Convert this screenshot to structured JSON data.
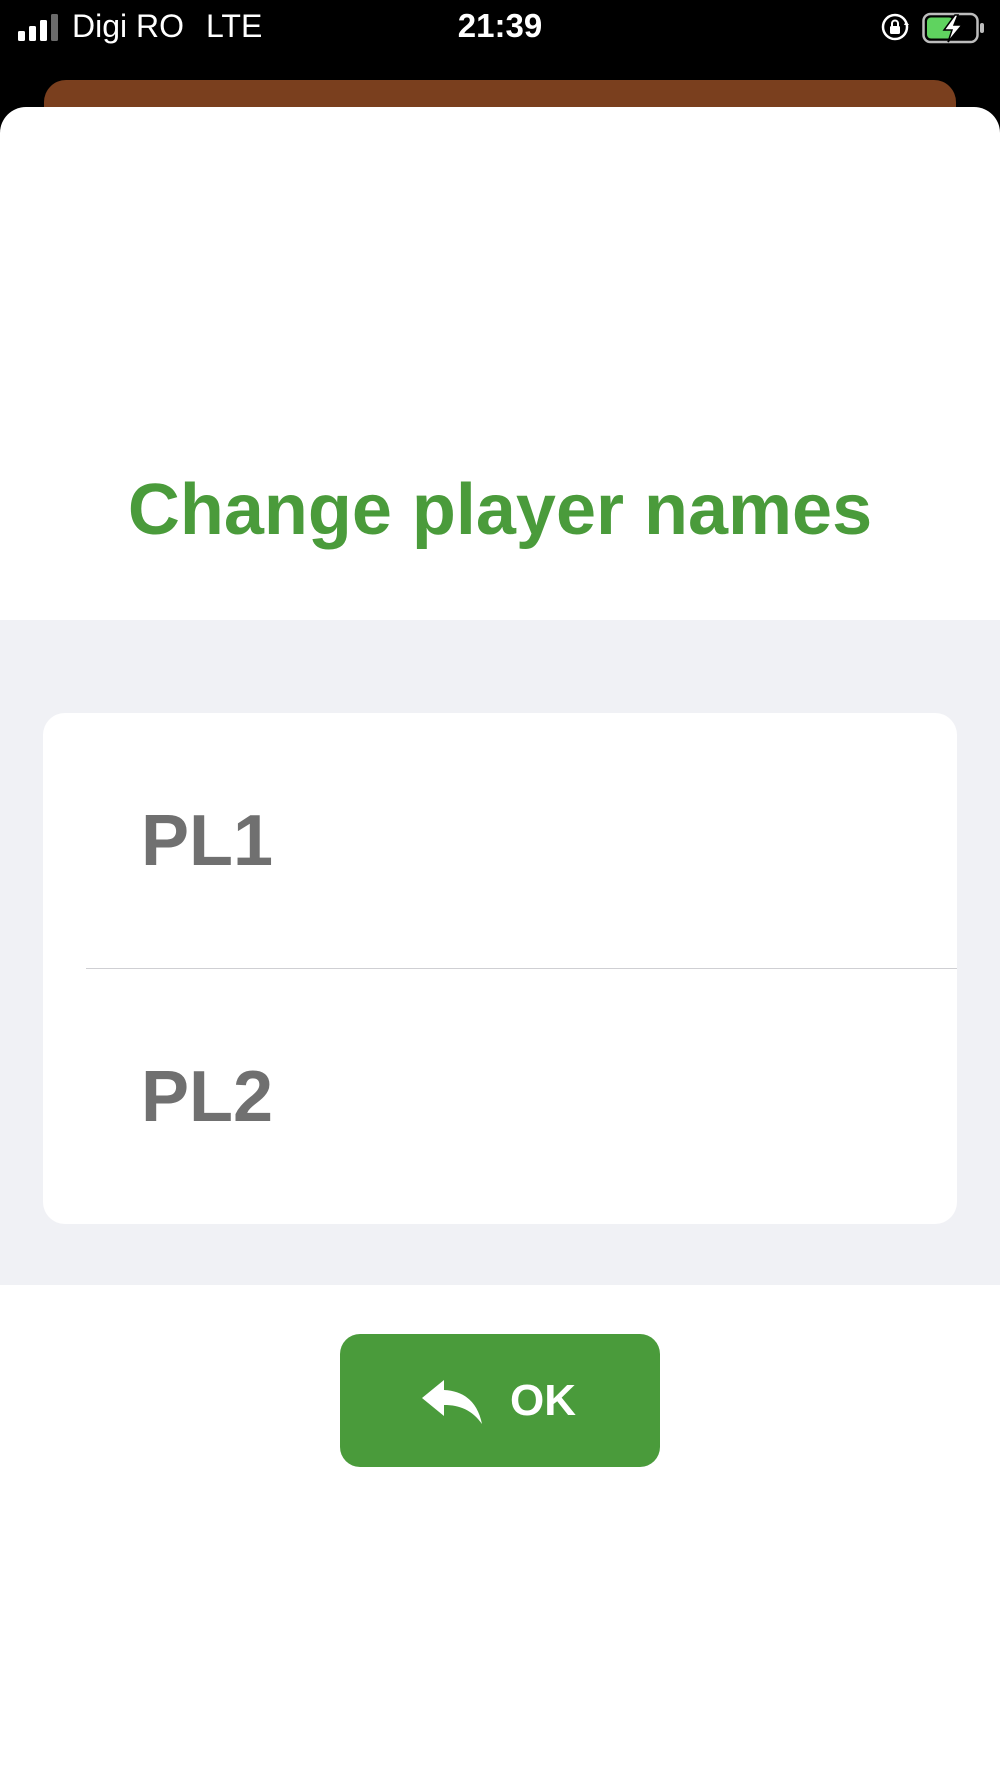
{
  "status_bar": {
    "carrier": "Digi RO",
    "network": "LTE",
    "time": "21:39",
    "signal_icon": "signal-bars-icon",
    "lock_icon": "orientation-lock-icon",
    "battery_icon": "battery-charging-icon"
  },
  "dialog": {
    "title": "Change player names",
    "players": [
      {
        "placeholder": "PL1",
        "value": ""
      },
      {
        "placeholder": "PL2",
        "value": ""
      }
    ],
    "ok_button": {
      "label": "OK",
      "icon": "reply-arrow-icon"
    }
  },
  "colors": {
    "accent_green": "#4a9b3b",
    "title_green": "#4a9b3b",
    "back_sheet_brown": "#7a3f1e",
    "grouped_background": "#f0f1f5",
    "placeholder_gray": "#707070",
    "battery_green": "#5fd35f"
  }
}
